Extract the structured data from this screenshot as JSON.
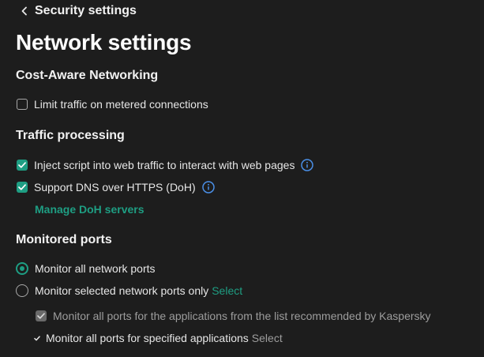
{
  "header": {
    "back_label": "Security settings",
    "page_title": "Network settings"
  },
  "sections": {
    "cost_aware": {
      "title": "Cost-Aware Networking",
      "limit_traffic": {
        "label": "Limit traffic on metered connections",
        "checked": false
      }
    },
    "traffic_processing": {
      "title": "Traffic processing",
      "inject_script": {
        "label": "Inject script into web traffic to interact with web pages",
        "checked": true
      },
      "support_doh": {
        "label": "Support DNS over HTTPS (DoH)",
        "checked": true
      },
      "manage_doh_link": "Manage DoH servers"
    },
    "monitored_ports": {
      "title": "Monitored ports",
      "monitor_all": {
        "label": "Monitor all network ports",
        "selected": true
      },
      "monitor_selected": {
        "label": "Monitor selected network ports only",
        "link": "Select",
        "selected": false
      },
      "recommended_apps": {
        "label": "Monitor all ports for the applications from the list recommended by Kaspersky",
        "checked": true,
        "disabled": true
      },
      "specified_apps": {
        "label": "Monitor all ports for specified applications",
        "link": "Select",
        "checked": true
      }
    }
  },
  "colors": {
    "accent": "#1e9e83",
    "background": "#1d1d1d",
    "info_icon": "#4a8fe7"
  },
  "icons": {
    "back": "chevron-left-icon",
    "info": "info-icon",
    "check": "checkmark-icon"
  }
}
